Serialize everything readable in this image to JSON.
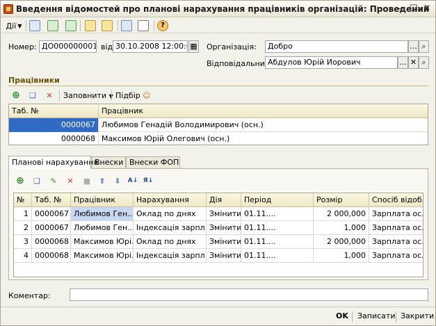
{
  "window": {
    "title": "Введення відомостей про планові нарахування працівників організацій: Проведений",
    "minimize": "–",
    "maximize": "☐",
    "close": "✕"
  },
  "toolbar": {
    "actions_label": "Дії",
    "help_symbol": "?"
  },
  "header": {
    "number_label": "Номер:",
    "number_value": "ДО000000001",
    "date_label": "від",
    "date_value": "30.10.2008 12:00:00",
    "org_label": "Організація:",
    "org_value": "Добро",
    "responsible_label": "Відповідальний:",
    "responsible_value": "Абдулов Юрій Иорович"
  },
  "employees": {
    "section_title": "Працівники",
    "fill_label": "Заповнити",
    "pick_label": "Підбір",
    "columns": [
      "Таб. №",
      "Працівник"
    ],
    "rows": [
      {
        "tab_no": "0000067",
        "name": "Любимов Генадій Володимирович (осн.)"
      },
      {
        "tab_no": "0000068",
        "name": "Максимов Юрій Олегович (осн.)"
      }
    ]
  },
  "tabs": [
    "Планові нарахування",
    "Внески",
    "Внески ФОП"
  ],
  "accruals": {
    "columns": [
      "№",
      "Таб. №",
      "Працівник",
      "Нарахування",
      "Дія",
      "Період",
      "Розмір",
      "Спосіб відоб..."
    ],
    "rows": [
      {
        "n": "1",
        "tab_no": "0000067",
        "employee": "Любимов Ген...",
        "accrual": "Оклад по днях",
        "action": "Змінити",
        "period": "01.11....",
        "size": "2 000,000",
        "method": "Зарплата ос..."
      },
      {
        "n": "2",
        "tab_no": "0000067",
        "employee": "Любимов Ген...",
        "accrual": "Індексація зарпл...",
        "action": "Змінити",
        "period": "01.11....",
        "size": "1,000",
        "method": "Зарплата ос..."
      },
      {
        "n": "3",
        "tab_no": "0000068",
        "employee": "Максимов Юрі...",
        "accrual": "Оклад по днях",
        "action": "Змінити",
        "period": "01.11....",
        "size": "2 000,000",
        "method": "Зарплата ос..."
      },
      {
        "n": "4",
        "tab_no": "0000068",
        "employee": "Максимов Юрі...",
        "accrual": "Індексація зарпл...",
        "action": "Змінити",
        "period": "01.11....",
        "size": "1,000",
        "method": "Зарплата ос..."
      }
    ]
  },
  "comment": {
    "label": "Коментар:",
    "value": ""
  },
  "footer": {
    "ok": "OK",
    "save": "Записати",
    "close": "Закрити"
  }
}
